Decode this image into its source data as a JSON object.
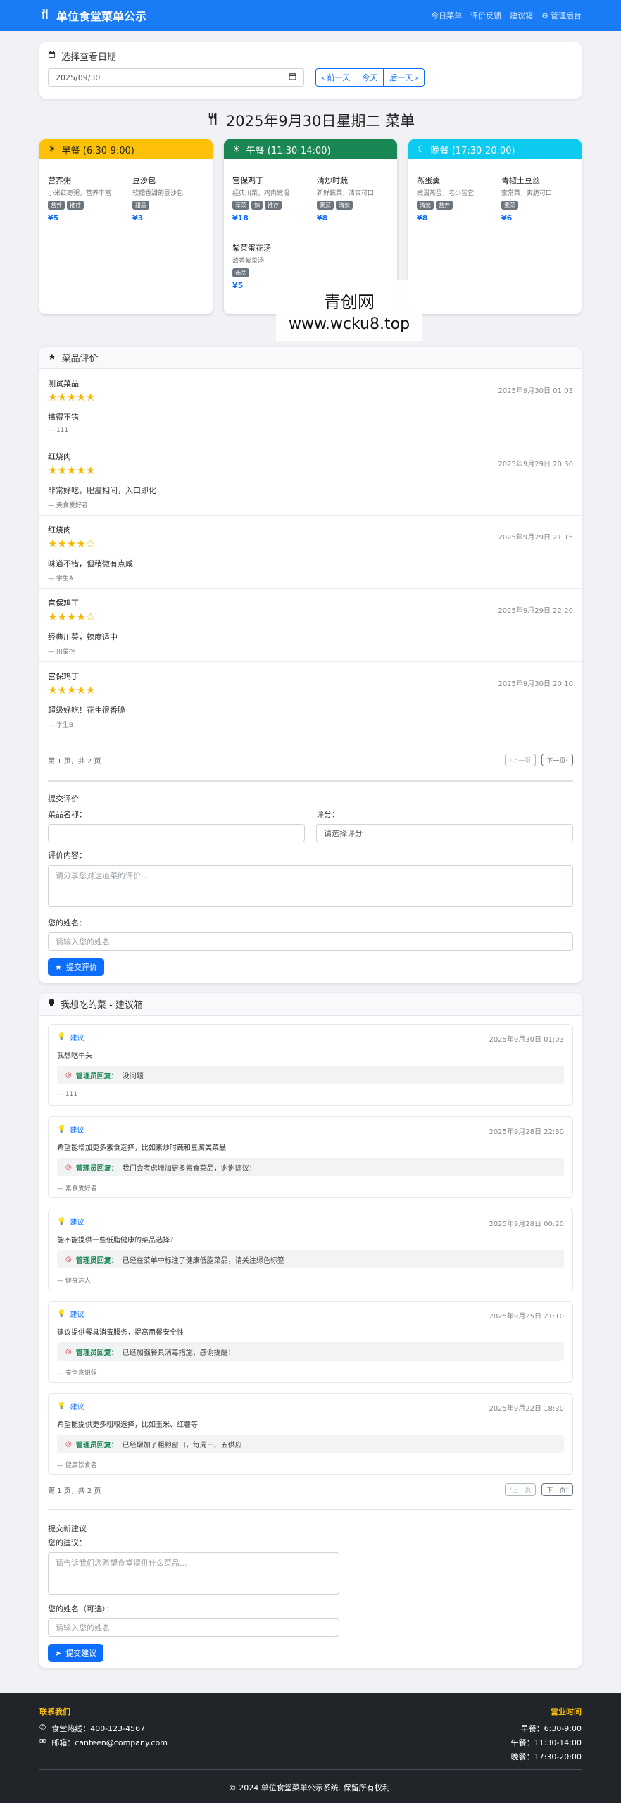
{
  "nav": {
    "brand": "单位食堂菜单公示",
    "links": [
      "今日菜单",
      "评价反馈",
      "建议箱",
      "管理后台"
    ]
  },
  "date_picker": {
    "title": "选择查看日期",
    "value": "2025/09/30",
    "prev": "前一天",
    "today": "今天",
    "next": "后一天"
  },
  "menu_title": "2025年9月30日星期二 菜单",
  "meals": [
    {
      "name": "早餐 (6:30-9:00)",
      "color": "#ffc107",
      "text_color": "#212529",
      "icon": "sun-icon",
      "dishes": [
        {
          "name": "营养粥",
          "desc": "小米红枣粥，营养丰富",
          "tags": [
            "营养",
            "推荐"
          ],
          "price": "¥5"
        },
        {
          "name": "豆沙包",
          "desc": "软糯香甜的豆沙包",
          "tags": [
            "甜品"
          ],
          "price": "¥3"
        }
      ]
    },
    {
      "name": "午餐 (11:30-14:00)",
      "color": "#198754",
      "text_color": "#ffffff",
      "icon": "sun-icon",
      "dishes": [
        {
          "name": "宫保鸡丁",
          "desc": "经典川菜，鸡肉嫩滑",
          "tags": [
            "荤菜",
            "辣",
            "推荐"
          ],
          "price": "¥18"
        },
        {
          "name": "清炒时蔬",
          "desc": "新鲜蔬菜，清爽可口",
          "tags": [
            "素菜",
            "清淡"
          ],
          "price": "¥8"
        },
        {
          "name": "紫菜蛋花汤",
          "desc": "清香紫菜汤",
          "tags": [
            "汤品"
          ],
          "price": "¥5"
        }
      ]
    },
    {
      "name": "晚餐 (17:30-20:00)",
      "color": "#0dcaf0",
      "text_color": "#ffffff",
      "icon": "moon-icon",
      "dishes": [
        {
          "name": "蒸蛋羹",
          "desc": "嫩滑蒸蛋，老少皆宜",
          "tags": [
            "清淡",
            "营养"
          ],
          "price": "¥8"
        },
        {
          "name": "青椒土豆丝",
          "desc": "家常菜，爽脆可口",
          "tags": [
            "素菜"
          ],
          "price": "¥6"
        }
      ]
    }
  ],
  "watermark": {
    "line1": "青创网",
    "line2": "www.wcku8.top"
  },
  "reviews": {
    "title": "菜品评价",
    "items": [
      {
        "dish": "测试菜品",
        "time": "2025年9月30日 01:03",
        "rating": 5,
        "comment": "搞得不错",
        "user": "— 111"
      },
      {
        "dish": "红烧肉",
        "time": "2025年9月29日 20:30",
        "rating": 5,
        "comment": "非常好吃，肥瘦相间，入口即化",
        "user": "— 美食爱好者"
      },
      {
        "dish": "红烧肉",
        "time": "2025年9月29日 21:15",
        "rating": 4,
        "comment": "味道不错，但稍微有点咸",
        "user": "— 学生A"
      },
      {
        "dish": "宫保鸡丁",
        "time": "2025年9月29日 22:20",
        "rating": 4,
        "comment": "经典川菜，辣度适中",
        "user": "— 川菜控"
      },
      {
        "dish": "宫保鸡丁",
        "time": "2025年9月30日 20:10",
        "rating": 5,
        "comment": "超级好吃！花生很香脆",
        "user": "— 学生B"
      }
    ],
    "pager": "第 1 页，共 2 页",
    "prev": "上一页",
    "next": "下一页",
    "form": {
      "title": "提交评价",
      "dish_label": "菜品名称：",
      "rating_label": "评分：",
      "rating_placeholder": "请选择评分",
      "content_label": "评价内容：",
      "content_placeholder": "请分享您对这道菜的评价...",
      "name_label": "您的姓名：",
      "name_placeholder": "请输入您的姓名",
      "submit": "提交评价"
    }
  },
  "suggestions": {
    "title": "我想吃的菜 - 建议箱",
    "items": [
      {
        "kind": "建议",
        "time": "2025年9月30日 01:03",
        "content": "我想吃牛头",
        "reply_label": "管理员回复：",
        "reply": "没问题",
        "user": "— 111"
      },
      {
        "kind": "建议",
        "time": "2025年9月28日 22:30",
        "content": "希望能增加更多素食选择，比如素炒时蔬和豆腐类菜品",
        "reply_label": "管理员回复：",
        "reply": "我们会考虑增加更多素食菜品，谢谢建议！",
        "user": "— 素食爱好者"
      },
      {
        "kind": "建议",
        "time": "2025年9月28日 00:20",
        "content": "能不能提供一些低脂健康的菜品选择？",
        "reply_label": "管理员回复：",
        "reply": "已经在菜单中标注了健康低脂菜品，请关注绿色标签",
        "user": "— 健身达人"
      },
      {
        "kind": "建议",
        "time": "2025年9月25日 21:10",
        "content": "建议提供餐具消毒服务，提高用餐安全性",
        "reply_label": "管理员回复：",
        "reply": "已经加强餐具消毒措施，感谢提醒！",
        "user": "— 安全意识强"
      },
      {
        "kind": "建议",
        "time": "2025年9月22日 18:30",
        "content": "希望能提供更多粗粮选择，比如玉米、红薯等",
        "reply_label": "管理员回复：",
        "reply": "已经增加了粗粮窗口，每周三、五供应",
        "user": "— 健康饮食者"
      }
    ],
    "pager": "第 1 页，共 2 页",
    "prev": "上一页",
    "next": "下一页",
    "form": {
      "title": "提交新建议",
      "content_label": "您的建议：",
      "content_placeholder": "请告诉我们您希望食堂提供什么菜品...",
      "name_label": "您的姓名（可选）：",
      "name_placeholder": "请输入您的姓名",
      "submit": "提交建议"
    }
  },
  "footer": {
    "contact_title": "联系我们",
    "phone": "食堂热线：400-123-4567",
    "email": "邮箱：canteen@company.com",
    "hours_title": "营业时间",
    "breakfast": "早餐：6:30-9:00",
    "lunch": "午餐：11:30-14:00",
    "dinner": "晚餐：17:30-20:00",
    "copyright": "© 2024 单位食堂菜单公示系统. 保留所有权利."
  }
}
